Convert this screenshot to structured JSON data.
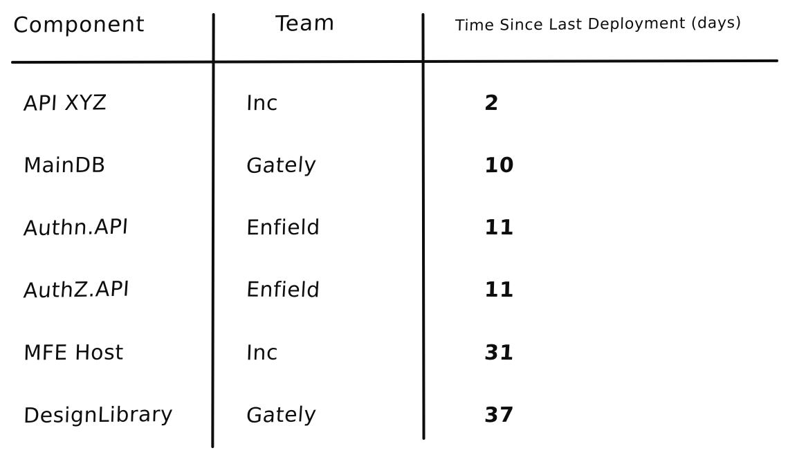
{
  "style": {
    "background_color": "#ffffff",
    "ink_color": "#0d0d0d"
  },
  "table": {
    "headers": [
      {
        "label": "Component",
        "align": "left"
      },
      {
        "label": "Team",
        "align": "center"
      },
      {
        "label": "Time Since Last Deployment (days)",
        "align": "left"
      }
    ],
    "rows": [
      {
        "component": "API XYZ",
        "team": "Inc",
        "days": "2"
      },
      {
        "component": "MainDB",
        "team": "Gately",
        "days": "10"
      },
      {
        "component": "Authn.API",
        "team": "Enfield",
        "days": "11"
      },
      {
        "component": "AuthZ.API",
        "team": "Enfield",
        "days": "11"
      },
      {
        "component": "MFE Host",
        "team": "Inc",
        "days": "31"
      },
      {
        "component": "DesignLibrary",
        "team": "Gately",
        "days": "37"
      }
    ]
  },
  "chart_data": {
    "type": "table",
    "title": "",
    "columns": [
      "Component",
      "Team",
      "Time Since Last Deployment (days)"
    ],
    "categories": [
      "API XYZ",
      "MainDB",
      "Authn.API",
      "AuthZ.API",
      "MFE Host",
      "DesignLibrary"
    ],
    "series": [
      {
        "name": "Time Since Last Deployment (days)",
        "values": [
          2,
          10,
          11,
          11,
          31,
          37
        ]
      }
    ],
    "teams": [
      "Inc",
      "Gately",
      "Enfield",
      "Enfield",
      "Inc",
      "Gately"
    ],
    "rows": [
      [
        "API XYZ",
        "Inc",
        2
      ],
      [
        "MainDB",
        "Gately",
        10
      ],
      [
        "Authn.API",
        "Enfield",
        11
      ],
      [
        "AuthZ.API",
        "Enfield",
        11
      ],
      [
        "MFE Host",
        "Inc",
        31
      ],
      [
        "DesignLibrary",
        "Gately",
        37
      ]
    ],
    "xlabel": "",
    "ylabel": "Time Since Last Deployment (days)",
    "grid": false,
    "legend": "none"
  }
}
